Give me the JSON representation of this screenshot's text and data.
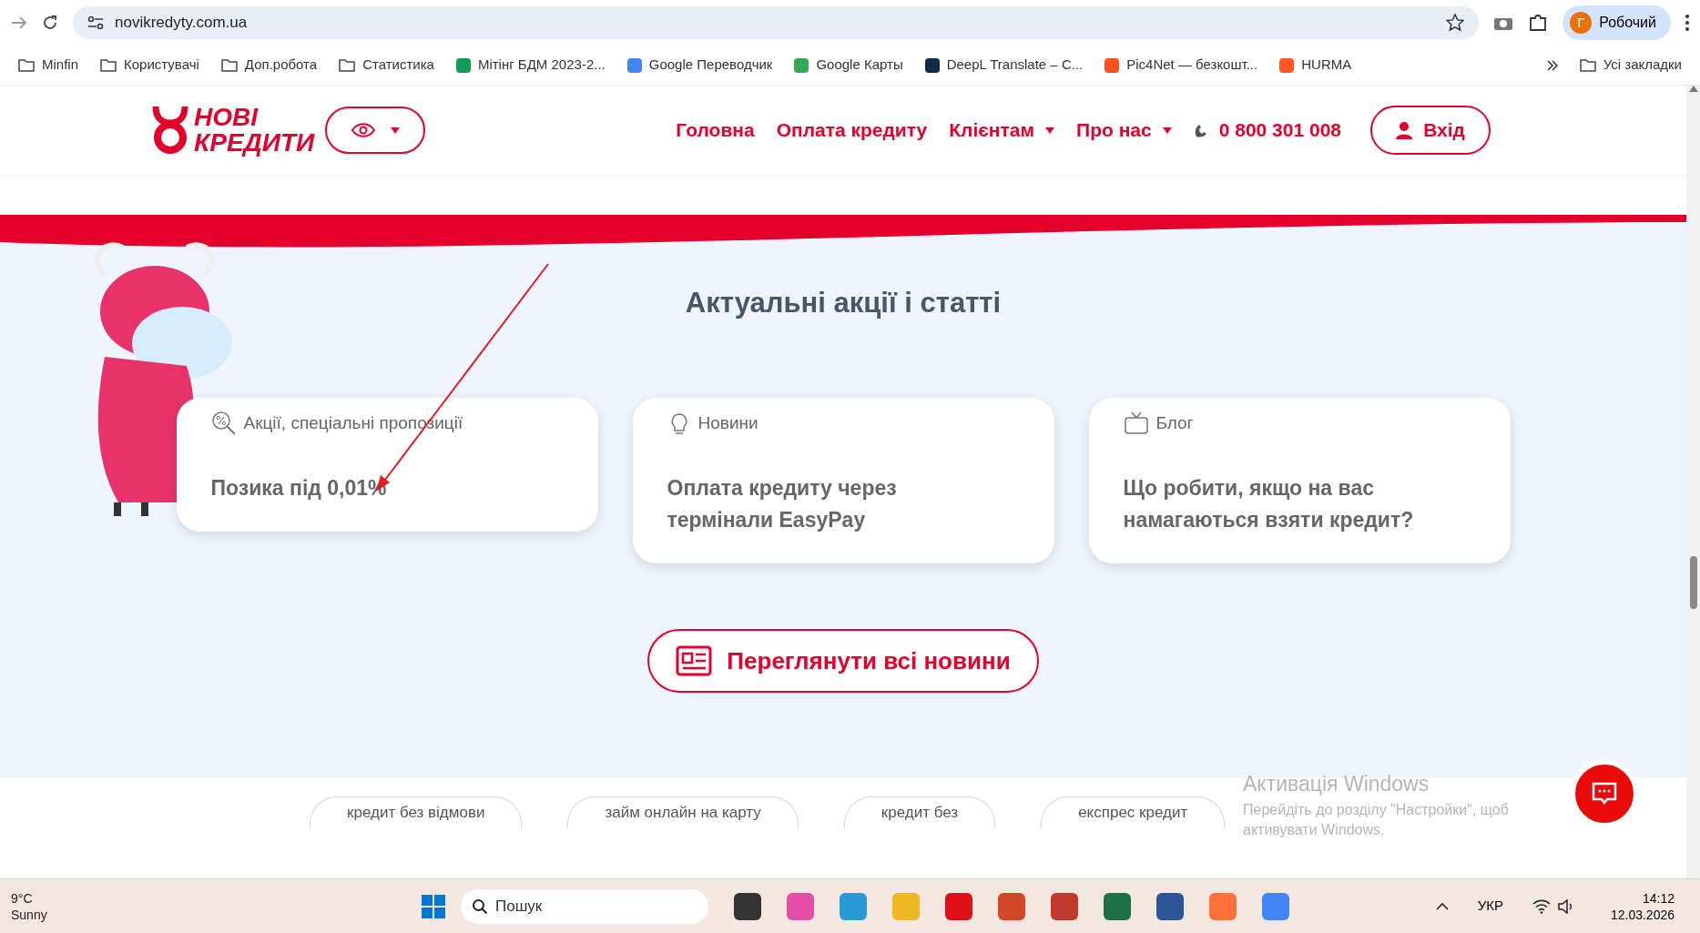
{
  "browser": {
    "url": "novikredyty.com.ua",
    "profile": {
      "initial": "Г",
      "name": "Робочий"
    },
    "bookmarks": [
      {
        "label": "Minfin",
        "kind": "folder"
      },
      {
        "label": "Користувачі",
        "kind": "folder"
      },
      {
        "label": "Доп.робота",
        "kind": "folder"
      },
      {
        "label": "Статистика",
        "kind": "folder"
      },
      {
        "label": "Мітінг БДМ 2023-2...",
        "kind": "site",
        "color": "#0f9d58"
      },
      {
        "label": "Google Переводчик",
        "kind": "site",
        "color": "#4285f4"
      },
      {
        "label": "Google Карты",
        "kind": "site",
        "color": "#34a853"
      },
      {
        "label": "DeepL Translate – C...",
        "kind": "site",
        "color": "#0f2b46"
      },
      {
        "label": "Pic4Net — безкошт...",
        "kind": "site",
        "color": "#f4511e"
      },
      {
        "label": "HURMA",
        "kind": "site",
        "color": "#ff5722"
      }
    ],
    "all_bookmarks": "Усі закладки"
  },
  "header": {
    "logo": [
      "НОВІ",
      "КРЕДИТИ"
    ],
    "nav": [
      {
        "label": "Головна",
        "dropdown": false
      },
      {
        "label": "Оплата кредиту",
        "dropdown": false
      },
      {
        "label": "Клієнтам",
        "dropdown": true
      },
      {
        "label": "Про нас",
        "dropdown": true
      }
    ],
    "phone": "0 800 301 008",
    "login": "Вхід"
  },
  "section": {
    "title": "Актуальні акції і статті",
    "cards": [
      {
        "kind": "promo",
        "category": "Акції, спеціальні пропозиції",
        "title": "Позика під 0,01%"
      },
      {
        "kind": "news",
        "category": "Новини",
        "title": "Оплата кредиту через термінали EasyPay"
      },
      {
        "kind": "blog",
        "category": "Блог",
        "title": "Що робити, якщо на вас намагаються взяти кредит?"
      }
    ],
    "all_news": "Переглянути всі новини"
  },
  "tags": [
    "кредит без відмови",
    "займ онлайн на карту",
    "кредит без",
    "експрес кредит"
  ],
  "activation": {
    "title": "Активація Windows",
    "text": "Перейдіть до розділу \"Настройки\", щоб активувати Windows."
  },
  "taskbar": {
    "weather": {
      "temp": "9°C",
      "desc": "Sunny"
    },
    "search": "Пошук",
    "lang": "УКР",
    "time": "14:12",
    "date": "12.03.2026"
  }
}
